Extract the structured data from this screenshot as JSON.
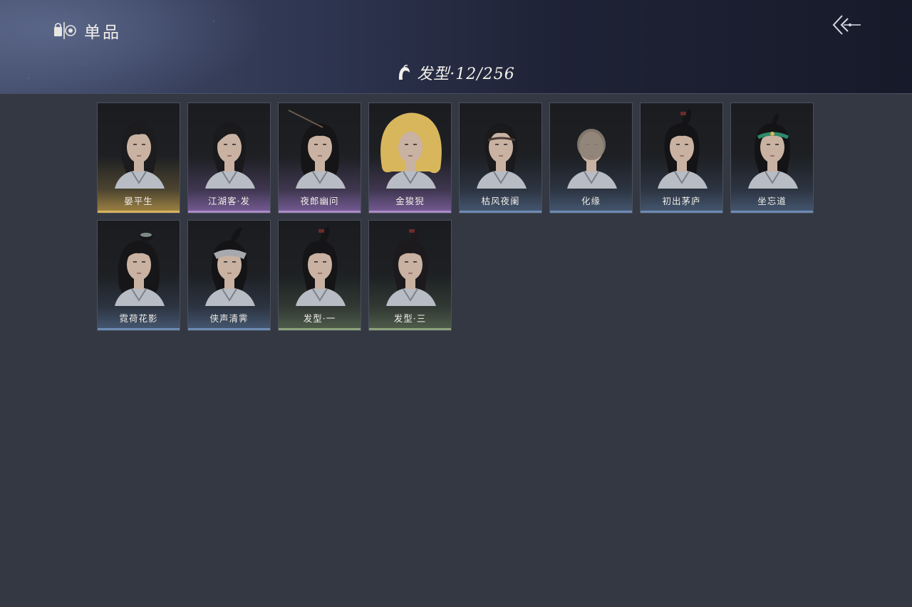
{
  "header": {
    "title": "单品",
    "title_icon": "shop-bag-icon",
    "back_icon": "back-arrow-icon",
    "subtitle": "发型·12/256",
    "subtitle_icon": "hair-icon"
  },
  "items": [
    {
      "label": "晏平生",
      "rarity": "gold",
      "hair": "#1c1b1d",
      "style": "messy"
    },
    {
      "label": "江湖客·发",
      "rarity": "purple",
      "hair": "#1a191c",
      "style": "swept"
    },
    {
      "label": "夜郎幽问",
      "rarity": "purple",
      "hair": "#151416",
      "style": "long-pin"
    },
    {
      "label": "金狻猊",
      "rarity": "purple",
      "hair": "#d8b65c",
      "style": "mane"
    },
    {
      "label": "枯风夜阑",
      "rarity": "blue",
      "hair": "#1a191b",
      "style": "headband"
    },
    {
      "label": "化缘",
      "rarity": "blue",
      "hair": "#8c7f74",
      "style": "bald"
    },
    {
      "label": "初出茅庐",
      "rarity": "blue",
      "hair": "#141316",
      "style": "ponytail"
    },
    {
      "label": "坐忘道",
      "rarity": "blue",
      "hair": "#141316",
      "style": "jade-band"
    },
    {
      "label": "霓荷花影",
      "rarity": "blue",
      "hair": "#161517",
      "style": "bun-long"
    },
    {
      "label": "侠声清霁",
      "rarity": "blue",
      "hair": "#141315",
      "style": "bandana"
    },
    {
      "label": "发型·一",
      "rarity": "green",
      "hair": "#151416",
      "style": "ponytail"
    },
    {
      "label": "发型·三",
      "rarity": "green",
      "hair": "#1c1a1d",
      "style": "ponytail"
    }
  ],
  "colors": {
    "background": "#343842",
    "gold": "#d7b45e",
    "purple": "#a98bc6",
    "blue": "#6d8bb3",
    "green": "#8da27a",
    "skin": "#c9b2a2"
  }
}
